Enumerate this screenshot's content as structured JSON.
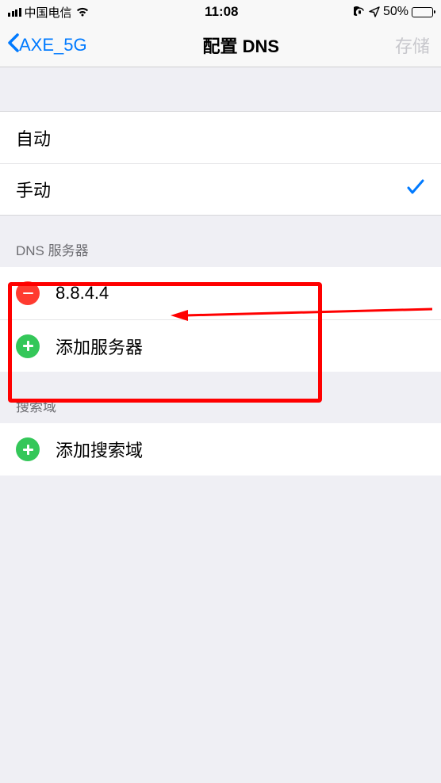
{
  "status": {
    "carrier": "中国电信",
    "time": "11:08",
    "battery_pct": "50%"
  },
  "nav": {
    "back_label": "AXE_5G",
    "title": "配置 DNS",
    "save_label": "存储"
  },
  "mode": {
    "auto_label": "自动",
    "manual_label": "手动"
  },
  "dns": {
    "header": "DNS 服务器",
    "servers": [
      "8.8.4.4"
    ],
    "add_label": "添加服务器"
  },
  "search_domains": {
    "header": "搜索域",
    "add_label": "添加搜索域"
  }
}
